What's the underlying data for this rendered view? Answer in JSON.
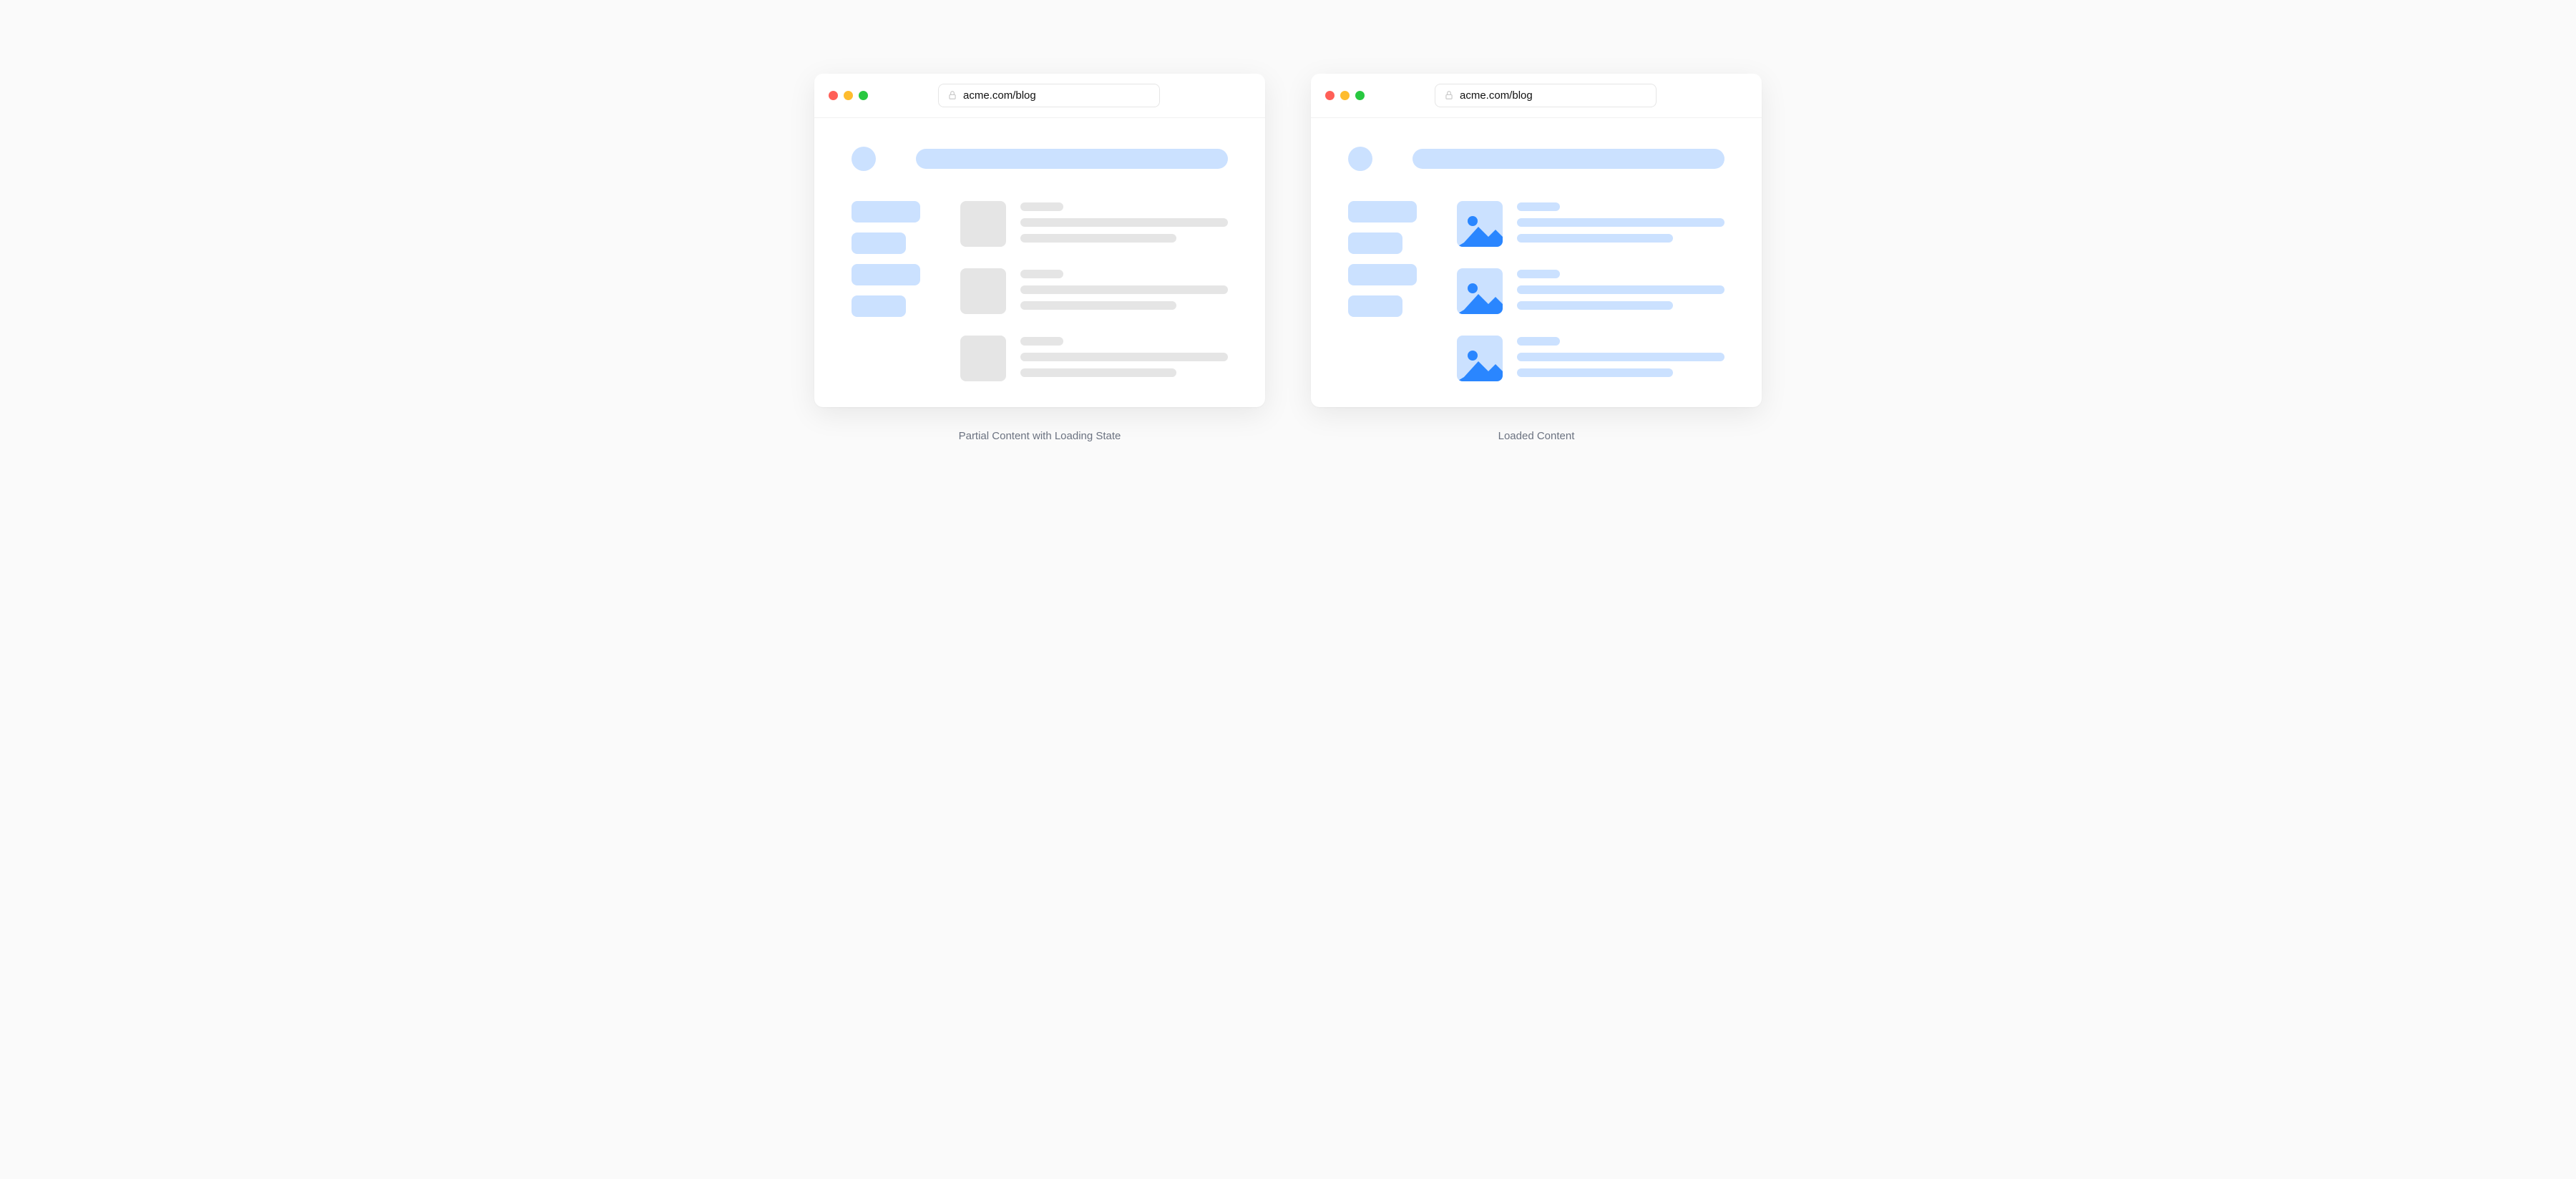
{
  "browsers": {
    "left": {
      "url": "acme.com/blog",
      "caption": "Partial Content with Loading State"
    },
    "right": {
      "url": "acme.com/blog",
      "caption": "Loaded Content"
    }
  },
  "colors": {
    "skeleton_gray": "#e5e5e5",
    "skeleton_blue": "#CBE1FF",
    "image_accent": "#2a86ff",
    "traffic_red": "#ff5f57",
    "traffic_yellow": "#febc2e",
    "traffic_green": "#28c840"
  }
}
